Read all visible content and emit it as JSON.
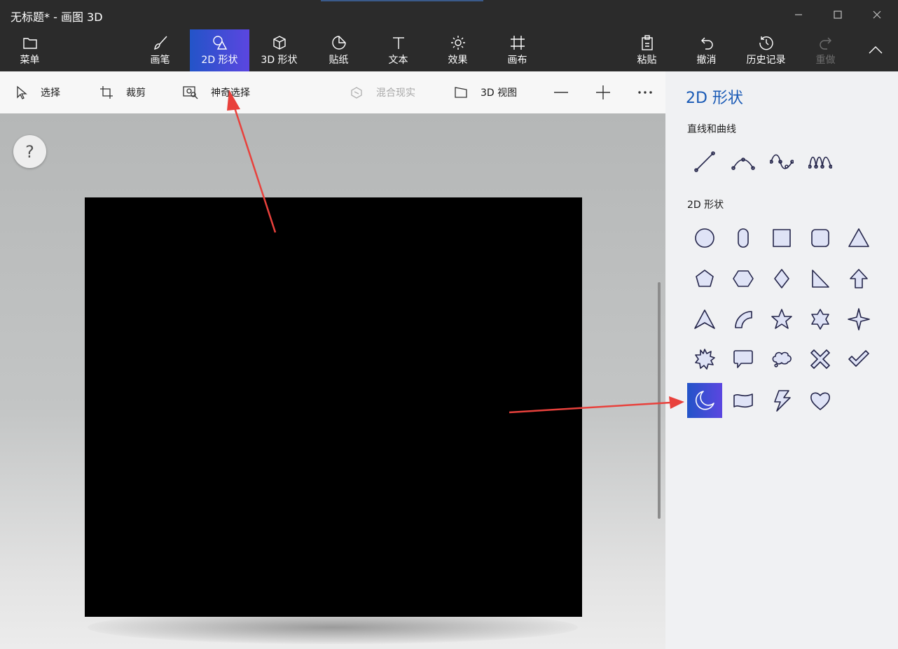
{
  "window": {
    "title": "无标题* - 画图 3D",
    "controls": [
      "minimize",
      "maximize",
      "close"
    ]
  },
  "ribbon": {
    "menu": {
      "label": "菜单",
      "icon": "folder-icon"
    },
    "tools": [
      {
        "label": "画笔",
        "icon": "brush-icon"
      },
      {
        "label": "2D 形状",
        "icon": "2d-shapes-icon",
        "active": true
      },
      {
        "label": "3D 形状",
        "icon": "cube-icon"
      },
      {
        "label": "贴纸",
        "icon": "sticker-icon"
      },
      {
        "label": "文本",
        "icon": "text-icon"
      },
      {
        "label": "效果",
        "icon": "sun-icon"
      },
      {
        "label": "画布",
        "icon": "canvas-icon"
      }
    ],
    "actions": [
      {
        "label": "粘贴",
        "icon": "paste-icon"
      },
      {
        "label": "撤消",
        "icon": "undo-icon"
      },
      {
        "label": "历史记录",
        "icon": "history-icon"
      },
      {
        "label": "重做",
        "icon": "redo-icon",
        "disabled": true
      }
    ],
    "collapse_icon": "chevron-up-icon"
  },
  "toolbar": {
    "select": "选择",
    "crop": "裁剪",
    "magic_select": "神奇选择",
    "mixed_reality": "混合现实",
    "view_3d": "3D 视图",
    "zoom_out_icon": "minus-icon",
    "zoom_in_icon": "plus-icon",
    "more_icon": "ellipsis-icon"
  },
  "workspace": {
    "help": "?",
    "canvas_color": "#000000"
  },
  "panel": {
    "title": "2D 形状",
    "lines_section": "直线和曲线",
    "shapes_section": "2D 形状",
    "lines": [
      "line-icon",
      "curve-icon",
      "three-point-curve-icon",
      "four-point-curve-icon"
    ],
    "shapes": [
      "circle-icon",
      "capsule-icon",
      "square-icon",
      "rounded-square-icon",
      "triangle-icon",
      "pentagon-icon",
      "hexagon-icon",
      "diamond-icon",
      "right-triangle-icon",
      "arrow-up-icon",
      "arrowhead-icon",
      "quarter-circle-icon",
      "five-point-star-icon",
      "six-point-star-icon",
      "four-point-star-icon",
      "burst-icon",
      "speech-bubble-icon",
      "thought-bubble-icon",
      "x-mark-icon",
      "check-mark-icon",
      "moon-icon",
      "banner-icon",
      "lightning-icon",
      "heart-icon"
    ],
    "selected_shape": "moon-icon"
  },
  "colors": {
    "ribbon_bg": "#2b2b2b",
    "accent_start": "#2354c8",
    "accent_end": "#5b46e0",
    "panel_title": "#1859b5",
    "annotation_arrow": "#e8413c"
  }
}
